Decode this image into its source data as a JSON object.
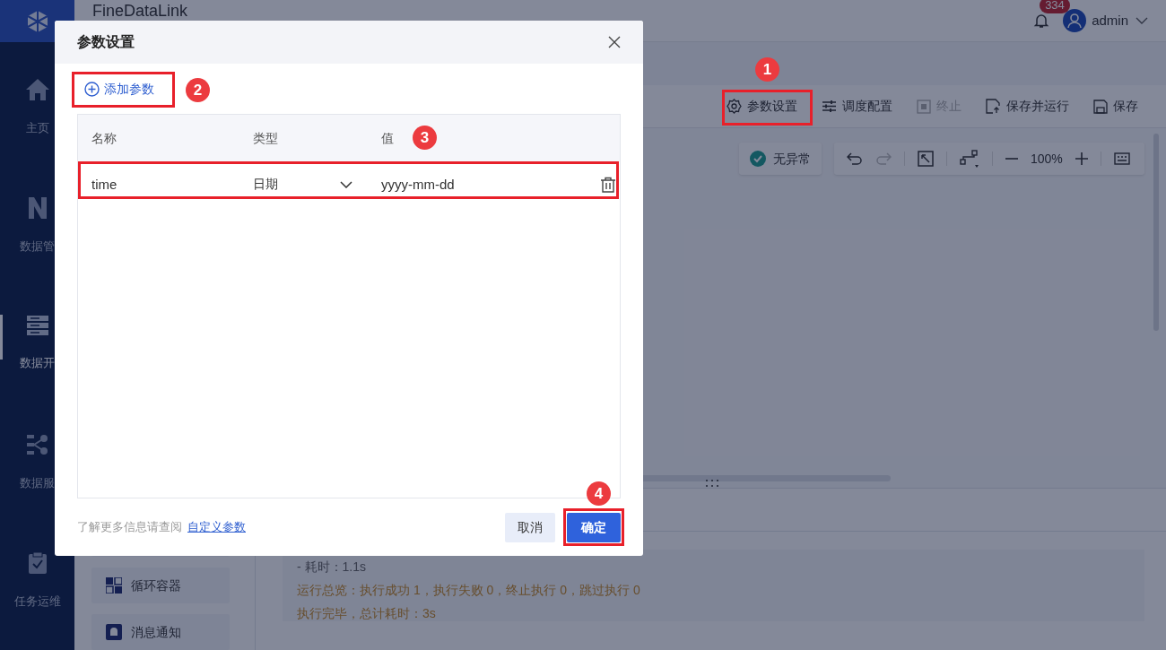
{
  "app": {
    "title": "FineDataLink",
    "notifications": "334",
    "user": "admin"
  },
  "sidebar": {
    "items": [
      {
        "label": "主页",
        "selected": false
      },
      {
        "label": "数据管",
        "selected": false
      },
      {
        "label": "数据开",
        "selected": true
      },
      {
        "label": "数据服",
        "selected": false
      },
      {
        "label": "任务运维",
        "selected": false
      }
    ]
  },
  "toolbar": {
    "buttons": [
      {
        "label": "参数设置",
        "disabled": false
      },
      {
        "label": "调度配置",
        "disabled": false
      },
      {
        "label": "终止",
        "disabled": true
      },
      {
        "label": "保存并运行",
        "disabled": false
      },
      {
        "label": "保存",
        "disabled": false
      }
    ]
  },
  "canvas": {
    "status": "无异常",
    "zoom": "100%"
  },
  "components": [
    {
      "label": "循环容器"
    },
    {
      "label": "消息通知"
    }
  ],
  "log": {
    "lines": [
      {
        "text": "- 耗时：1.1s",
        "kind": "plain"
      },
      {
        "text": "运行总览：执行成功 1，执行失败 0，终止执行 0，跳过执行 0",
        "kind": "summary"
      },
      {
        "text": "执行完毕，总计耗时：3s",
        "kind": "summary"
      }
    ]
  },
  "dialog": {
    "title": "参数设置",
    "add_button": "添加参数",
    "columns": [
      "名称",
      "类型",
      "值"
    ],
    "rows": [
      {
        "name": "time",
        "type": "日期",
        "value": "yyyy-mm-dd"
      }
    ],
    "footer_note": "了解更多信息请查阅",
    "footer_link": "自定义参数",
    "buttons": [
      {
        "label": "取消",
        "primary": false
      },
      {
        "label": "确定",
        "primary": true
      }
    ]
  },
  "callouts": [
    {
      "number": "1"
    },
    {
      "number": "2"
    },
    {
      "number": "3"
    },
    {
      "number": "4"
    }
  ]
}
